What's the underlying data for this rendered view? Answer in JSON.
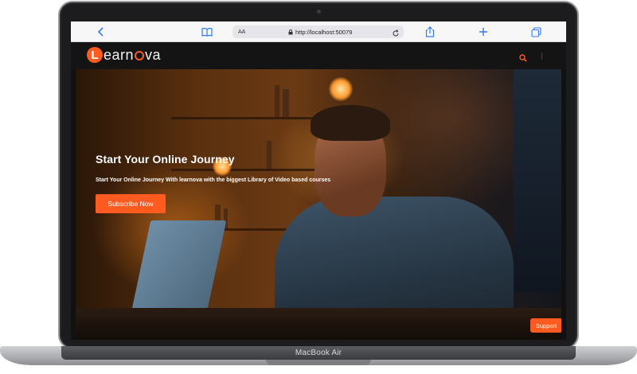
{
  "browser": {
    "aa_label": "AA",
    "url": "http://localhost:50079"
  },
  "site": {
    "logo_initial": "L",
    "logo_text_before_o": "earn",
    "logo_text_after_o": "va"
  },
  "hero": {
    "title": "Start Your Online Journey",
    "subtitle": "Start Your Online Journey With learnova with the biggest Library of Video based courses",
    "cta_label": "Subscribe Now"
  },
  "support": {
    "label": "Support"
  },
  "device": {
    "label": "MacBook Air"
  },
  "colors": {
    "accent": "#ff5a1f",
    "header_bg": "#141414",
    "browser_link": "#2e7cf6"
  },
  "icons": {
    "back": "chevron-left-icon",
    "reader": "book-icon",
    "lock": "lock-icon",
    "reload": "reload-icon",
    "share": "share-icon",
    "new_tab": "plus-icon",
    "tabs": "tabs-icon",
    "search": "search-icon"
  }
}
